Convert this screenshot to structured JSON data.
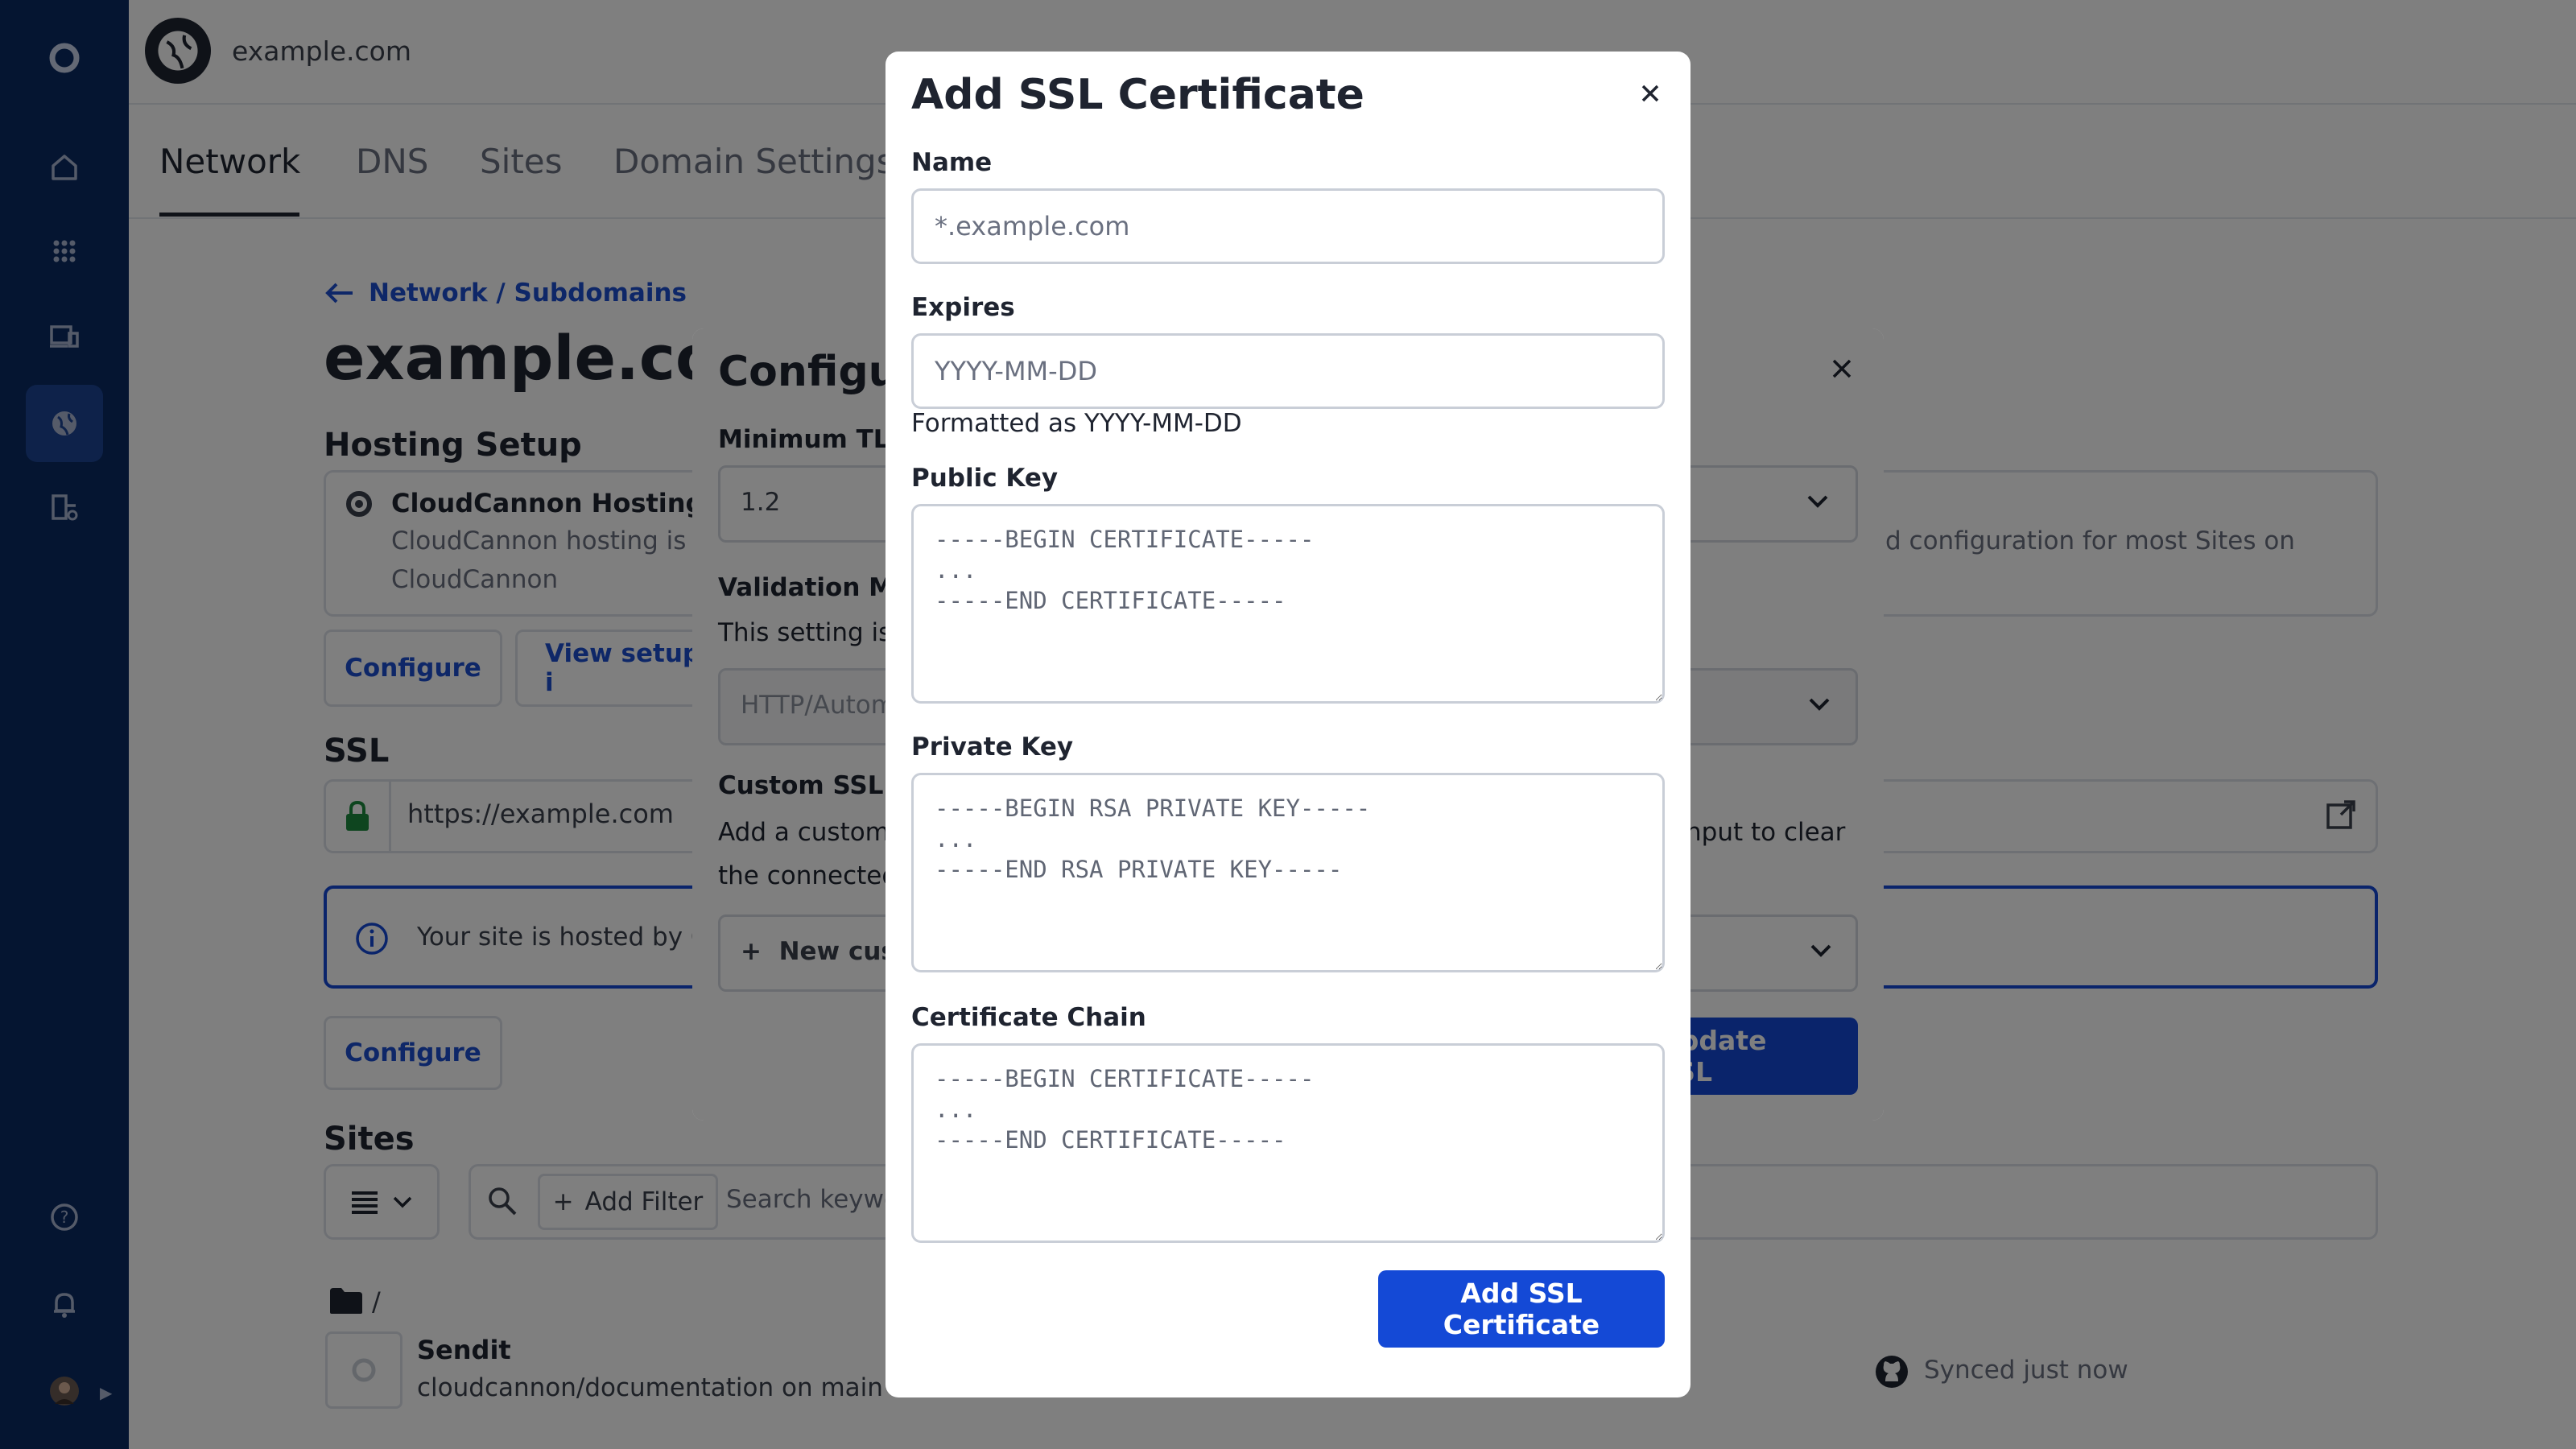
{
  "header": {
    "site_name": "example.com"
  },
  "tabs": [
    {
      "label": "Network"
    },
    {
      "label": "DNS"
    },
    {
      "label": "Sites"
    },
    {
      "label": "Domain Settings"
    }
  ],
  "page": {
    "breadcrumb": "Network / Subdomains",
    "title": "example.com",
    "hosting": {
      "heading": "Hosting Setup",
      "provider": "CloudCannon Hosting",
      "desc_left": "CloudCannon hosting is a",
      "desc_left_2": "CloudCannon",
      "desc_right": "d configuration for most Sites on",
      "configure_label": "Configure",
      "view_setup_label": "View setup i"
    },
    "ssl": {
      "heading": "SSL",
      "url": "https://example.com",
      "info": "Your site is hosted by Cl",
      "configure_label": "Configure"
    },
    "sites": {
      "heading": "Sites",
      "add_filter_label": "Add Filter",
      "search_placeholder": "Search keywo",
      "folder": "/",
      "site_name": "Sendit",
      "site_repo": "cloudcannon/documentation on main",
      "sync_status": "Synced just now"
    }
  },
  "config_modal": {
    "title": "Configur",
    "min_tls_label": "Minimum TLS",
    "min_tls_value": "1.2",
    "validation_label": "Validation Me",
    "validation_desc": "This setting is",
    "validation_value": "HTTP/Autom",
    "custom_ssl_label": "Custom SSL Ce",
    "custom_ssl_desc_1": "Add a custom",
    "custom_ssl_desc_2": "the connected",
    "custom_ssl_desc_right": "nput to clear",
    "new_custom_label": "New cus",
    "update_label": "Update SSL"
  },
  "ssl_modal": {
    "title": "Add SSL Certificate",
    "name_label": "Name",
    "name_placeholder": "*.example.com",
    "expires_label": "Expires",
    "expires_placeholder": "YYYY-MM-DD",
    "expires_hint": "Formatted as YYYY-MM-DD",
    "public_key_label": "Public Key",
    "public_key_placeholder": "-----BEGIN CERTIFICATE-----\n...\n-----END CERTIFICATE-----",
    "private_key_label": "Private Key",
    "private_key_placeholder": "-----BEGIN RSA PRIVATE KEY-----\n...\n-----END RSA PRIVATE KEY-----",
    "chain_label": "Certificate Chain",
    "chain_placeholder": "-----BEGIN CERTIFICATE-----\n...\n-----END CERTIFICATE-----",
    "submit_label": "Add SSL Certificate"
  },
  "colors": {
    "rail": "#0b2a63",
    "rail_active": "#1c4495",
    "primary": "#1449d6",
    "link": "#1c4fd0"
  }
}
